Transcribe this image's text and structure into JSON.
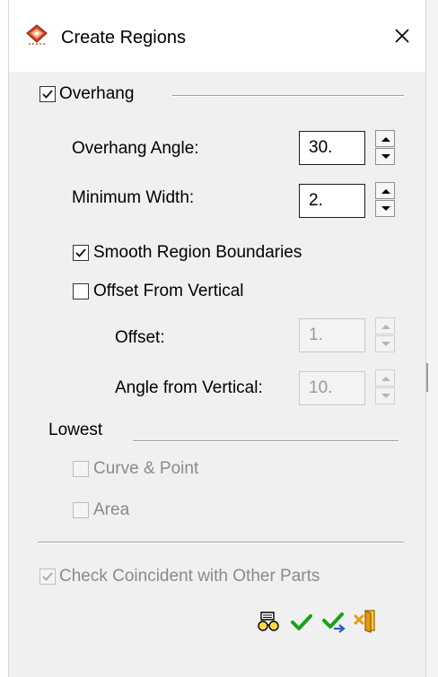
{
  "window": {
    "title": "Create Regions"
  },
  "overhang": {
    "label": "Overhang",
    "checked": true,
    "angle_label": "Overhang Angle:",
    "angle_value": "30.",
    "width_label": "Minimum Width:",
    "width_value": "2."
  },
  "smooth": {
    "label": "Smooth Region Boundaries",
    "checked": true
  },
  "offset_from_vertical": {
    "label": "Offset From Vertical",
    "checked": false,
    "offset_label": "Offset:",
    "offset_value": "1.",
    "angle_label": "Angle from Vertical:",
    "angle_value": "10."
  },
  "lowest": {
    "label": "Lowest",
    "curve_point_label": "Curve & Point",
    "area_label": "Area"
  },
  "check_coincident": {
    "label": "Check Coincident with Other Parts",
    "checked": true
  },
  "toolbar": {
    "icons": [
      "preview-icon",
      "ok-check-icon",
      "apply-check-icon",
      "exit-icon"
    ]
  },
  "colors": {
    "dialog_bg": "#f0f0f0",
    "check_green": "#18a318",
    "exit_orange": "#e49b0f"
  }
}
